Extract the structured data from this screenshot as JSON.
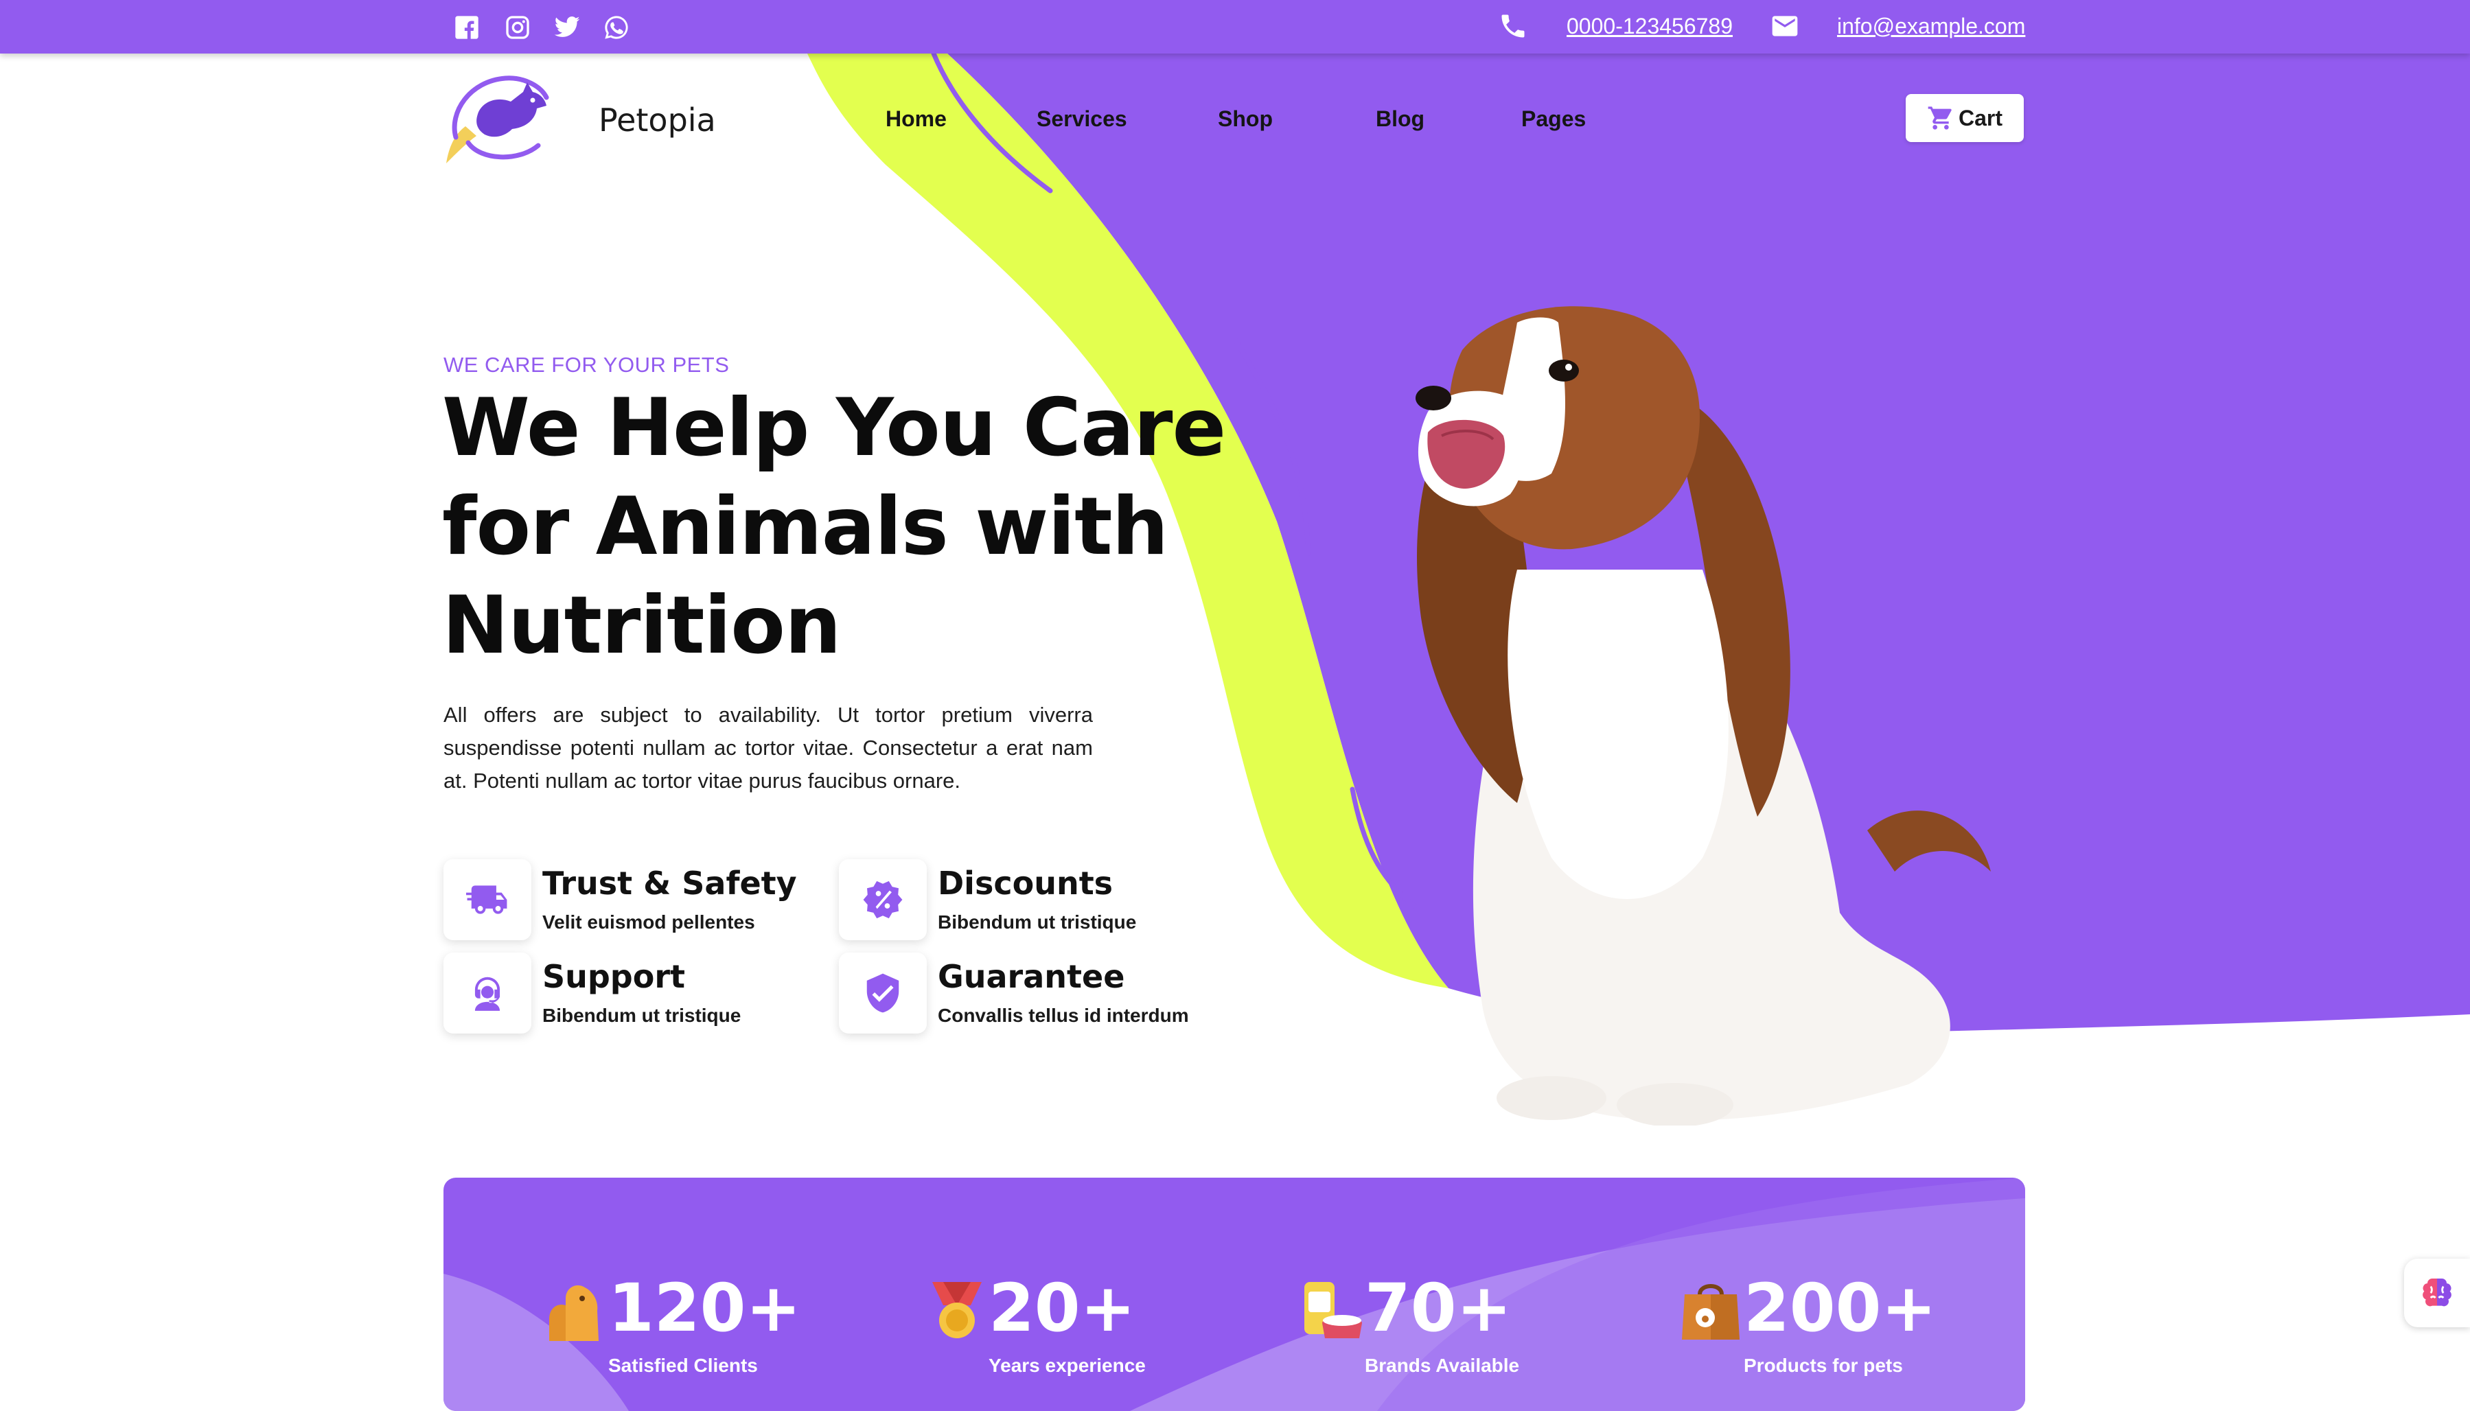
{
  "topbar": {
    "social": [
      "facebook-icon",
      "instagram-icon",
      "twitter-icon",
      "whatsapp-icon"
    ],
    "phone": "0000-123456789",
    "email": "info@example.com"
  },
  "header": {
    "brand": "Petopia",
    "nav": [
      "Home",
      "Services",
      "Shop",
      "Blog",
      "Pages"
    ],
    "cart_label": "Cart"
  },
  "hero": {
    "eyebrow": "WE CARE FOR YOUR PETS",
    "title": "We Help You Care for Animals with Nutrition",
    "description": "All offers are subject to availability. Ut tortor pretium viverra suspendisse potenti nullam ac tortor vitae. Consectetur a erat nam at. Potenti nullam ac tortor vitae purus faucibus ornare."
  },
  "features": [
    {
      "title": "Trust & Safety",
      "subtitle": "Velit euismod pellentes",
      "icon": "truck-icon"
    },
    {
      "title": "Discounts",
      "subtitle": "Bibendum ut tristique",
      "icon": "discount-badge-icon"
    },
    {
      "title": "Support",
      "subtitle": "Bibendum ut tristique",
      "icon": "support-agent-icon"
    },
    {
      "title": "Guarantee",
      "subtitle": "Convallis tellus id interdum",
      "icon": "shield-check-icon"
    }
  ],
  "stats": [
    {
      "value": "120+",
      "label": "Satisfied Clients",
      "icon": "pets-icon"
    },
    {
      "value": "20+",
      "label": "Years experience",
      "icon": "medal-icon"
    },
    {
      "value": "70+",
      "label": "Brands Available",
      "icon": "pet-food-icon"
    },
    {
      "value": "200+",
      "label": "Products for pets",
      "icon": "shopping-bag-icon"
    }
  ],
  "colors": {
    "primary": "#925bef",
    "lime": "#e3ff4f",
    "text": "#111111",
    "white": "#ffffff"
  }
}
